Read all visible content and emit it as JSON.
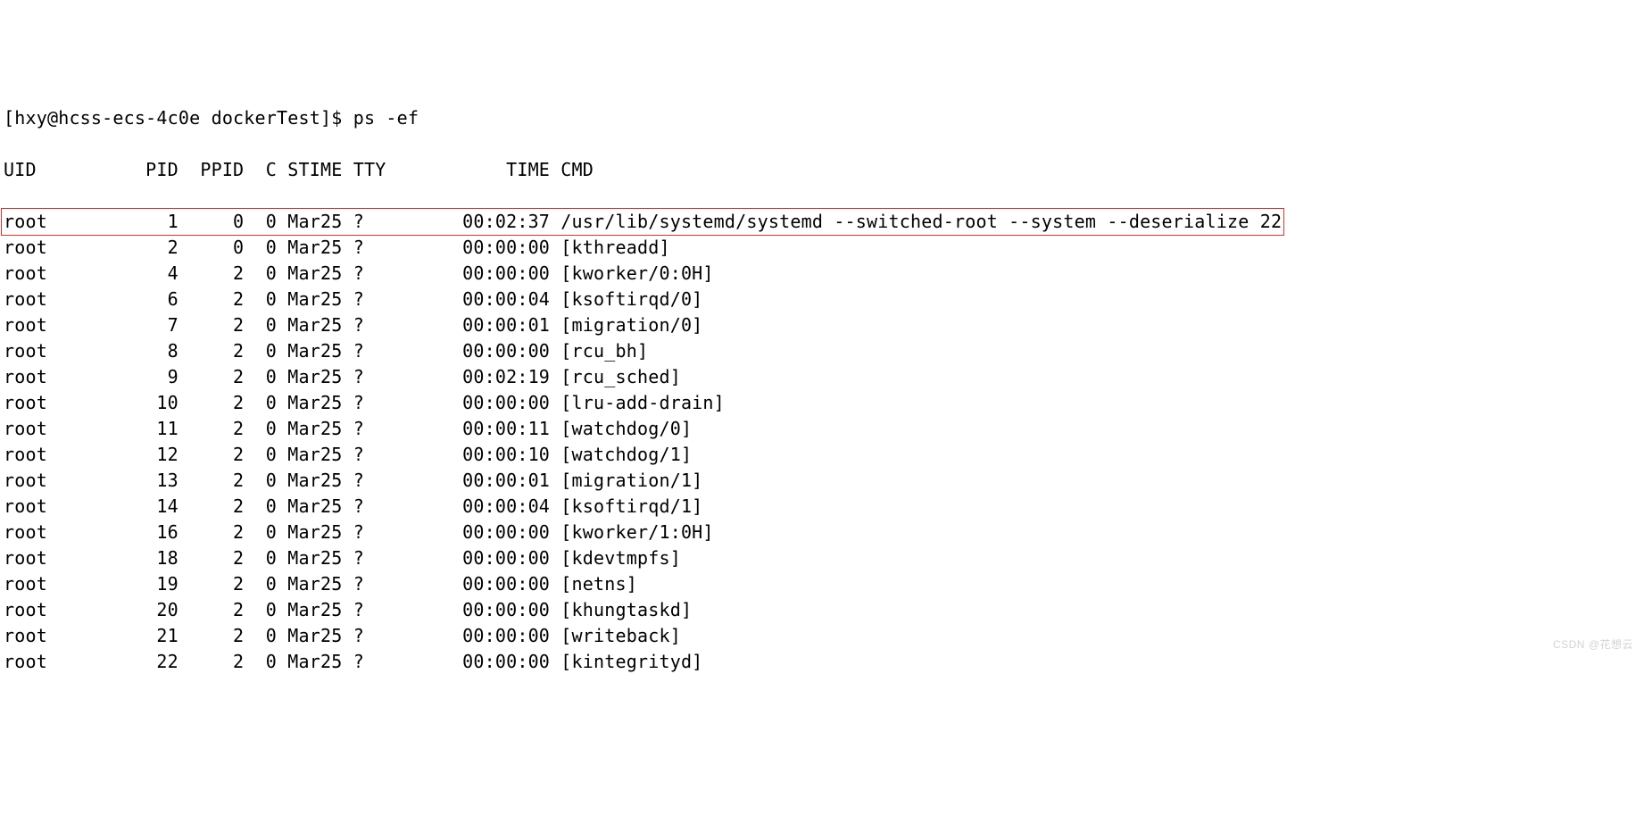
{
  "prompt_line": "[hxy@hcss-ecs-4c0e dockerTest]$ ps -ef",
  "header": {
    "uid": "UID",
    "pid": "PID",
    "ppid": "PPID",
    "c": "C",
    "stime": "STIME",
    "tty": "TTY",
    "time": "TIME",
    "cmd": "CMD"
  },
  "highlight_index": 0,
  "rows": [
    {
      "uid": "root",
      "pid": "1",
      "ppid": "0",
      "c": "0",
      "stime": "Mar25",
      "tty": "?",
      "time": "00:02:37",
      "cmd": "/usr/lib/systemd/systemd --switched-root --system --deserialize 22"
    },
    {
      "uid": "root",
      "pid": "2",
      "ppid": "0",
      "c": "0",
      "stime": "Mar25",
      "tty": "?",
      "time": "00:00:00",
      "cmd": "[kthreadd]"
    },
    {
      "uid": "root",
      "pid": "4",
      "ppid": "2",
      "c": "0",
      "stime": "Mar25",
      "tty": "?",
      "time": "00:00:00",
      "cmd": "[kworker/0:0H]"
    },
    {
      "uid": "root",
      "pid": "6",
      "ppid": "2",
      "c": "0",
      "stime": "Mar25",
      "tty": "?",
      "time": "00:00:04",
      "cmd": "[ksoftirqd/0]"
    },
    {
      "uid": "root",
      "pid": "7",
      "ppid": "2",
      "c": "0",
      "stime": "Mar25",
      "tty": "?",
      "time": "00:00:01",
      "cmd": "[migration/0]"
    },
    {
      "uid": "root",
      "pid": "8",
      "ppid": "2",
      "c": "0",
      "stime": "Mar25",
      "tty": "?",
      "time": "00:00:00",
      "cmd": "[rcu_bh]"
    },
    {
      "uid": "root",
      "pid": "9",
      "ppid": "2",
      "c": "0",
      "stime": "Mar25",
      "tty": "?",
      "time": "00:02:19",
      "cmd": "[rcu_sched]"
    },
    {
      "uid": "root",
      "pid": "10",
      "ppid": "2",
      "c": "0",
      "stime": "Mar25",
      "tty": "?",
      "time": "00:00:00",
      "cmd": "[lru-add-drain]"
    },
    {
      "uid": "root",
      "pid": "11",
      "ppid": "2",
      "c": "0",
      "stime": "Mar25",
      "tty": "?",
      "time": "00:00:11",
      "cmd": "[watchdog/0]"
    },
    {
      "uid": "root",
      "pid": "12",
      "ppid": "2",
      "c": "0",
      "stime": "Mar25",
      "tty": "?",
      "time": "00:00:10",
      "cmd": "[watchdog/1]"
    },
    {
      "uid": "root",
      "pid": "13",
      "ppid": "2",
      "c": "0",
      "stime": "Mar25",
      "tty": "?",
      "time": "00:00:01",
      "cmd": "[migration/1]"
    },
    {
      "uid": "root",
      "pid": "14",
      "ppid": "2",
      "c": "0",
      "stime": "Mar25",
      "tty": "?",
      "time": "00:00:04",
      "cmd": "[ksoftirqd/1]"
    },
    {
      "uid": "root",
      "pid": "16",
      "ppid": "2",
      "c": "0",
      "stime": "Mar25",
      "tty": "?",
      "time": "00:00:00",
      "cmd": "[kworker/1:0H]"
    },
    {
      "uid": "root",
      "pid": "18",
      "ppid": "2",
      "c": "0",
      "stime": "Mar25",
      "tty": "?",
      "time": "00:00:00",
      "cmd": "[kdevtmpfs]"
    },
    {
      "uid": "root",
      "pid": "19",
      "ppid": "2",
      "c": "0",
      "stime": "Mar25",
      "tty": "?",
      "time": "00:00:00",
      "cmd": "[netns]"
    },
    {
      "uid": "root",
      "pid": "20",
      "ppid": "2",
      "c": "0",
      "stime": "Mar25",
      "tty": "?",
      "time": "00:00:00",
      "cmd": "[khungtaskd]"
    },
    {
      "uid": "root",
      "pid": "21",
      "ppid": "2",
      "c": "0",
      "stime": "Mar25",
      "tty": "?",
      "time": "00:00:00",
      "cmd": "[writeback]"
    },
    {
      "uid": "root",
      "pid": "22",
      "ppid": "2",
      "c": "0",
      "stime": "Mar25",
      "tty": "?",
      "time": "00:00:00",
      "cmd": "[kintegrityd]"
    }
  ],
  "watermark": "CSDN @花想云"
}
